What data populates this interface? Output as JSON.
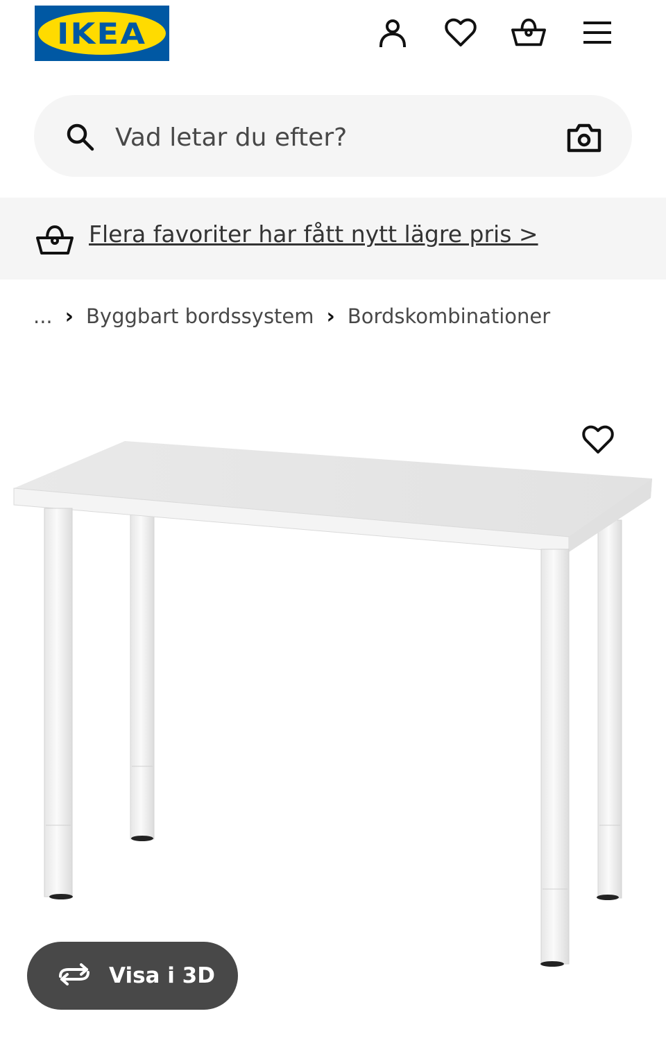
{
  "header": {
    "logo_text": "IKEA",
    "icons": [
      "account-icon",
      "heart-icon",
      "basket-icon",
      "menu-icon"
    ]
  },
  "search": {
    "placeholder": "Vad letar du efter?",
    "search_icon": "search-icon",
    "camera_icon": "camera-icon"
  },
  "promo": {
    "icon": "basket-icon",
    "link_text": "Flera favoriter har fått nytt lägre pris >"
  },
  "breadcrumb": {
    "items": [
      "...",
      "Byggbart bordssystem",
      "Bordskombinationer"
    ],
    "separator": "›"
  },
  "product": {
    "favorite_icon": "heart-icon",
    "view_3d_label": "Visa i 3D",
    "view_3d_icon": "rotate-icon"
  },
  "colors": {
    "brand_blue": "#0058a3",
    "brand_yellow": "#ffdb00",
    "surface_gray": "#f5f5f5",
    "button_dark": "#484848"
  }
}
